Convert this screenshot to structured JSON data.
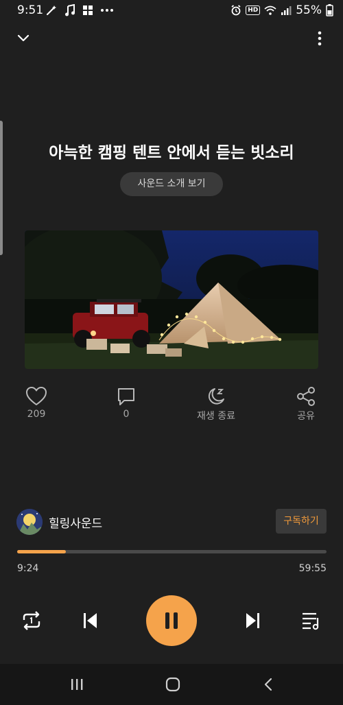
{
  "status_bar": {
    "time": "9:51",
    "left_icons": [
      "wand-icon",
      "music-note-icon",
      "app-grid-icon",
      "more-icon"
    ],
    "right_icons": [
      "alarm-icon",
      "hd-icon",
      "wifi-icon",
      "signal-icon"
    ],
    "hd_label": "HD",
    "battery": "55%"
  },
  "header": {
    "collapse_icon": "chevron-down-icon",
    "menu_icon": "more-vertical-icon"
  },
  "track": {
    "title": "아늑한 캠핑 텐트 안에서 듣는 빗소리",
    "intro_button": "사운드 소개 보기",
    "image": "camping-tent-night"
  },
  "actions": [
    {
      "icon": "heart-icon",
      "label": "209"
    },
    {
      "icon": "comment-icon",
      "label": "0"
    },
    {
      "icon": "sleep-moon-icon",
      "label": "재생 종료"
    },
    {
      "icon": "share-icon",
      "label": "공유"
    }
  ],
  "author": {
    "name": "힐링사운드",
    "subscribe_label": "구독하기"
  },
  "playback": {
    "elapsed": "9:24",
    "total": "59:55",
    "progress": 0.157
  },
  "controls": [
    "repeat-icon",
    "previous-icon",
    "pause-icon",
    "next-icon",
    "playlist-icon"
  ],
  "colors": {
    "accent": "#f5a34b",
    "background": "#1f1f1f",
    "subscribe_text": "#f39b3a"
  }
}
